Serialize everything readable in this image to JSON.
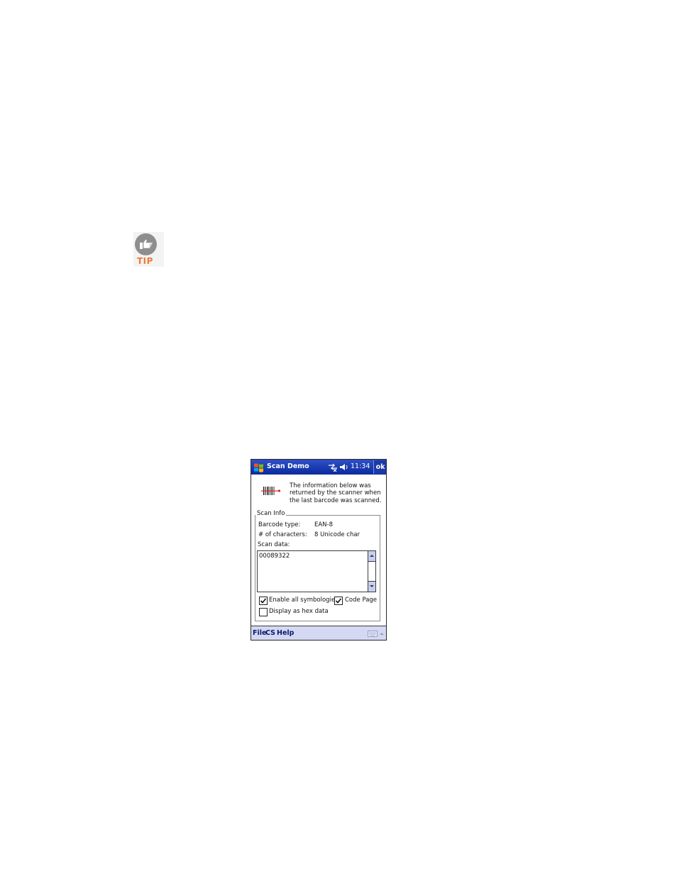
{
  "tip": {
    "label": "TIP",
    "icon": "pointing-hand-icon"
  },
  "window": {
    "title": "Scan Demo",
    "clock": "11:34",
    "ok_label": "ok",
    "start_icon": "windows-flag-icon",
    "status_icons": [
      "connectivity-icon",
      "speaker-icon"
    ],
    "title_bar_color": "#0a2a9c"
  },
  "intro": {
    "icon": "barcode-scanner-icon",
    "text": "The information below was returned by the scanner when the last barcode was scanned."
  },
  "scan_info": {
    "legend": "Scan Info",
    "barcode_type_label": "Barcode type:",
    "barcode_type_value": "EAN-8",
    "char_count_label": "# of characters:",
    "char_count_value": "8 Unicode char",
    "scan_data_label": "Scan data:",
    "scan_data_value": "00089322"
  },
  "options": {
    "enable_all": {
      "label": "Enable all symbologies",
      "checked": true
    },
    "code_page": {
      "label": "Code Page",
      "checked": true
    },
    "hex": {
      "label": "Display as hex data",
      "checked": false
    }
  },
  "menu": {
    "items": [
      "File",
      "CS",
      "Help"
    ],
    "keyboard_icon": "keyboard-icon"
  }
}
